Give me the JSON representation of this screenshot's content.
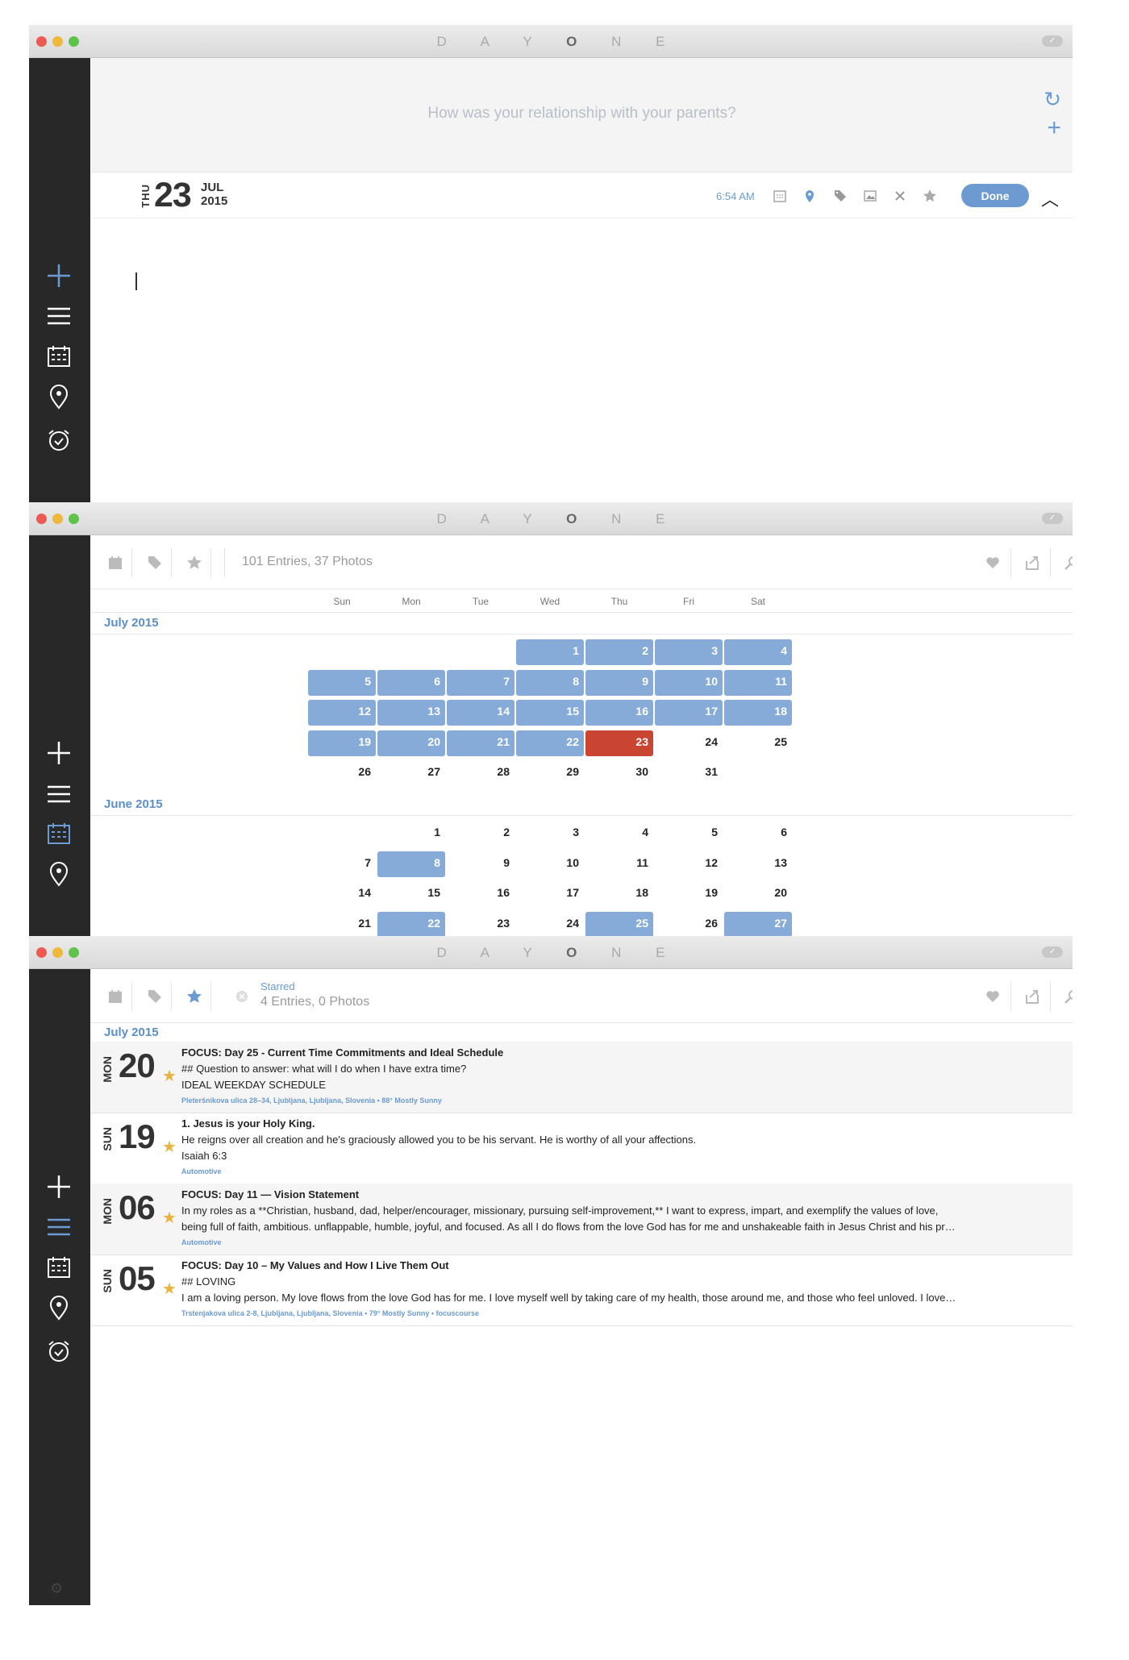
{
  "app": {
    "title_pre": "D A Y ",
    "title_bold": "O",
    "title_post": " N E"
  },
  "editor": {
    "prompt": "How was your relationship with your parents?",
    "date": {
      "dow": "THU",
      "day": "23",
      "month": "JUL",
      "year": "2015"
    },
    "time": "6:54 AM",
    "done_label": "Done"
  },
  "calendar": {
    "summary": "101 Entries, 37 Photos",
    "day_names": [
      "Sun",
      "Mon",
      "Tue",
      "Wed",
      "Thu",
      "Fri",
      "Sat"
    ],
    "months": [
      {
        "label": "July 2015",
        "weeks": [
          [
            "",
            "",
            "",
            "1",
            "2",
            "3",
            "4"
          ],
          [
            "5",
            "6",
            "7",
            "8",
            "9",
            "10",
            "11"
          ],
          [
            "12",
            "13",
            "14",
            "15",
            "16",
            "17",
            "18"
          ],
          [
            "19",
            "20",
            "21",
            "22",
            "23",
            "24",
            "25"
          ],
          [
            "26",
            "27",
            "28",
            "29",
            "30",
            "31",
            ""
          ]
        ],
        "entry_days": [
          "1",
          "2",
          "3",
          "4",
          "5",
          "6",
          "7",
          "8",
          "9",
          "10",
          "11",
          "12",
          "13",
          "14",
          "15",
          "16",
          "17",
          "18",
          "19",
          "20",
          "21",
          "22"
        ],
        "today": "23"
      },
      {
        "label": "June 2015",
        "weeks": [
          [
            "",
            "1",
            "2",
            "3",
            "4",
            "5",
            "6"
          ],
          [
            "7",
            "8",
            "9",
            "10",
            "11",
            "12",
            "13"
          ],
          [
            "14",
            "15",
            "16",
            "17",
            "18",
            "19",
            "20"
          ],
          [
            "21",
            "22",
            "23",
            "24",
            "25",
            "26",
            "27"
          ]
        ],
        "entry_days": [
          "8",
          "22",
          "25",
          "27"
        ],
        "today": ""
      }
    ]
  },
  "list": {
    "filter_label": "Starred",
    "summary": "4 Entries, 0 Photos",
    "month": "July 2015",
    "entries": [
      {
        "dow": "MON",
        "day": "20",
        "title": "FOCUS: Day 25 - Current Time Commitments and Ideal Schedule",
        "lines": [
          "## Question to answer: what will I do when I have extra time?",
          "IDEAL WEEKDAY SCHEDULE"
        ],
        "meta": "Pleteršnikova ulica 28–34, Ljubljana, Ljubljana, Slovenia  •  88° Mostly Sunny"
      },
      {
        "dow": "SUN",
        "day": "19",
        "title": "1. Jesus is your Holy King.",
        "lines": [
          "He reigns over all creation and he's graciously allowed you to be his servant. He is worthy of all your affections.",
          "Isaiah 6:3"
        ],
        "meta": "Automotive"
      },
      {
        "dow": "MON",
        "day": "06",
        "title": "FOCUS: Day 11 — Vision Statement",
        "lines": [
          "In my roles as a **Christian, husband, dad, helper/encourager, missionary, pursuing self-improvement,** I want to express, impart, and exemplify the values of love,",
          "being full of faith, ambitious. unflappable, humble, joyful, and focused. As all I do flows from the love God has for me and unshakeable faith in Jesus Christ and his pr…"
        ],
        "meta": "Automotive"
      },
      {
        "dow": "SUN",
        "day": "05",
        "title": "FOCUS: Day 10 – My Values and How I Live Them Out",
        "lines": [
          "## LOVING",
          "I am a loving person. My love flows from the love God has for me. I love myself well by taking care of my health, those around me, and those who feel unloved. I love…"
        ],
        "meta": "Trstenjakova ulica 2-8, Ljubljana, Ljubljana, Slovenia  •  79° Mostly Sunny  •  focuscourse"
      }
    ]
  },
  "colors": {
    "accent": "#6b9bd1",
    "entry_day": "#86abd8",
    "today": "#c94531",
    "sidebar": "#282828",
    "star": "#e8b440"
  }
}
